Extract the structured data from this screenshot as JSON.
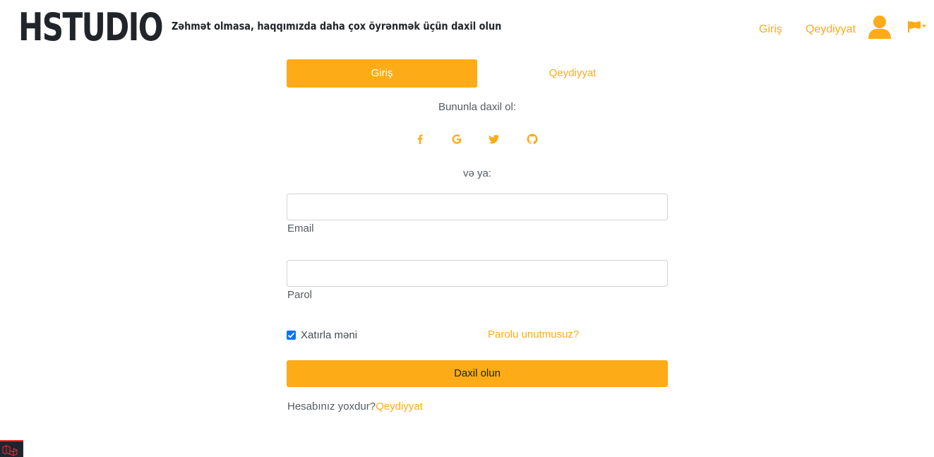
{
  "header": {
    "logo": "HSTUDIO",
    "tagline": "Zəhmət olmasa, haqqımızda daha çox öyrənmək üçün daxil olun",
    "nav": {
      "login": "Giriş",
      "register": "Qeydiyyat"
    },
    "icons": [
      "user-icon",
      "flag-icon"
    ]
  },
  "tabs": {
    "login": "Giriş",
    "register": "Qeydiyyat",
    "active": "login"
  },
  "form": {
    "signin_with": "Bununla daxil ol:",
    "social_icons": [
      "facebook-icon",
      "google-icon",
      "twitter-icon",
      "github-icon"
    ],
    "or_text": "və ya:",
    "email_label": "Email",
    "email_value": "",
    "password_label": "Parol",
    "password_value": "",
    "remember_label": "Xatırla məni",
    "remember_checked": true,
    "forgot_link": "Parolu unutmusuz?",
    "submit_label": "Daxil olun",
    "no_account_text": "Hesabınız yoxdur?",
    "register_link": "Qeydiyyat"
  },
  "colors": {
    "accent": "#fdab17",
    "text_dark": "#212529",
    "checkbox": "#0075ff"
  }
}
